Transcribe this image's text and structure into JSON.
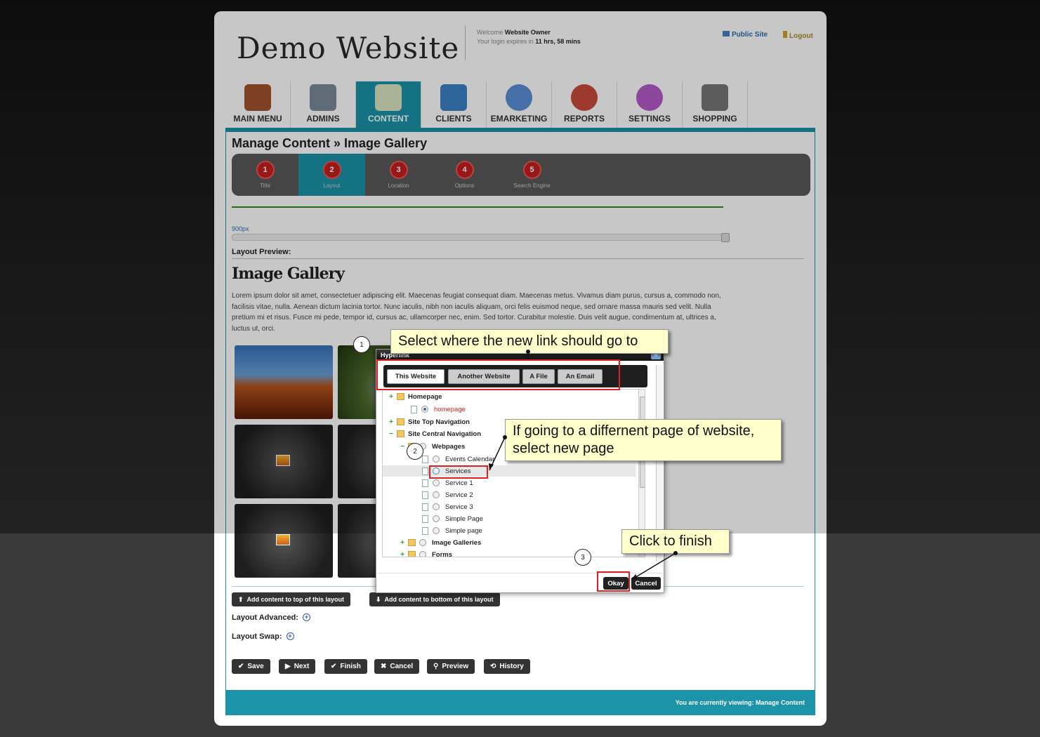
{
  "site": {
    "logo": "Demo Website",
    "welcome_prefix": "Welcome",
    "welcome_user": "Website Owner",
    "login_prefix": "Your login expires in",
    "login_time": "11 hrs, 58 mins",
    "public_site": "Public Site",
    "logout": "Logout"
  },
  "nav": [
    {
      "label": "MAIN MENU",
      "icon": "house-icon",
      "color": "#a0522d"
    },
    {
      "label": "ADMINS",
      "icon": "tools-icon",
      "color": "#7a8a99"
    },
    {
      "label": "CONTENT",
      "icon": "document-edit-icon",
      "color": "#d9e6c0",
      "active": true
    },
    {
      "label": "CLIENTS",
      "icon": "client-folder-icon",
      "color": "#3a80c6"
    },
    {
      "label": "EMARKETING",
      "icon": "email-at-icon",
      "color": "#5b8fd6"
    },
    {
      "label": "REPORTS",
      "icon": "report-chart-icon",
      "color": "#c94a3a"
    },
    {
      "label": "SETTINGS",
      "icon": "settings-gear-icon",
      "color": "#b45ac8"
    },
    {
      "label": "SHOPPING",
      "icon": "shopping-cart-icon",
      "color": "#777777"
    }
  ],
  "page": {
    "title": "Manage Content » Image Gallery",
    "steps": [
      {
        "num": "1",
        "label": "Title"
      },
      {
        "num": "2",
        "label": "Layout"
      },
      {
        "num": "3",
        "label": "Location"
      },
      {
        "num": "4",
        "label": "Options"
      },
      {
        "num": "5",
        "label": "Search Engine"
      }
    ],
    "width_label": "900px",
    "layout_preview": "Layout Preview:",
    "gallery_title": "Image Gallery",
    "lorem": "Lorem ipsum dolor sit amet, consectetuer adipiscing elit. Maecenas feugiat consequat diam. Maecenas metus. Vivamus diam purus, cursus a, commodo non, facilisis vitae, nulla. Aenean dictum lacinia tortor. Nunc iaculis, nibh non iaculis aliquam, orci felis euismod neque, sed ornare massa mauris sed velit. Nulla pretium mi et risus. Fusce mi pede, tempor id, cursus ac, ullamcorper nec, enim. Sed tortor. Curabitur molestie. Duis velit augue, condimentum at, ultrices a, luctus ut, orci.",
    "add_top": "Add content to top of this layout",
    "add_bottom": "Add content to bottom of this layout",
    "layout_advanced": "Layout Advanced:",
    "layout_swap": "Layout Swap:",
    "actions": {
      "save": "Save",
      "next": "Next",
      "finish": "Finish",
      "cancel": "Cancel",
      "preview": "Preview",
      "history": "History"
    },
    "footer": "You are currently viewing: Manage Content"
  },
  "dialog": {
    "title": "Hyperlink",
    "tabs": [
      "This Website",
      "Another Website",
      "A File",
      "An Email"
    ],
    "tree": {
      "homepage_folder": "Homepage",
      "homepage_page": "homepage",
      "top_nav": "Site Top Navigation",
      "central_nav": "Site Central Navigation",
      "webpages": "Webpages",
      "pages": [
        "Events Calendar",
        "Services",
        "Service 1",
        "Service 2",
        "Service 3",
        "Simple Page",
        "Simple page"
      ],
      "image_galleries": "Image Galleries",
      "forms": "Forms"
    },
    "okay": "Okay",
    "cancel": "Cancel"
  },
  "annotations": {
    "step1": "Select where the new link should go to",
    "step2_line1": "If going to a differnent page of website,",
    "step2_line2": "select new page",
    "step3": "Click to finish",
    "n1": "1",
    "n2": "2",
    "n3": "3"
  }
}
